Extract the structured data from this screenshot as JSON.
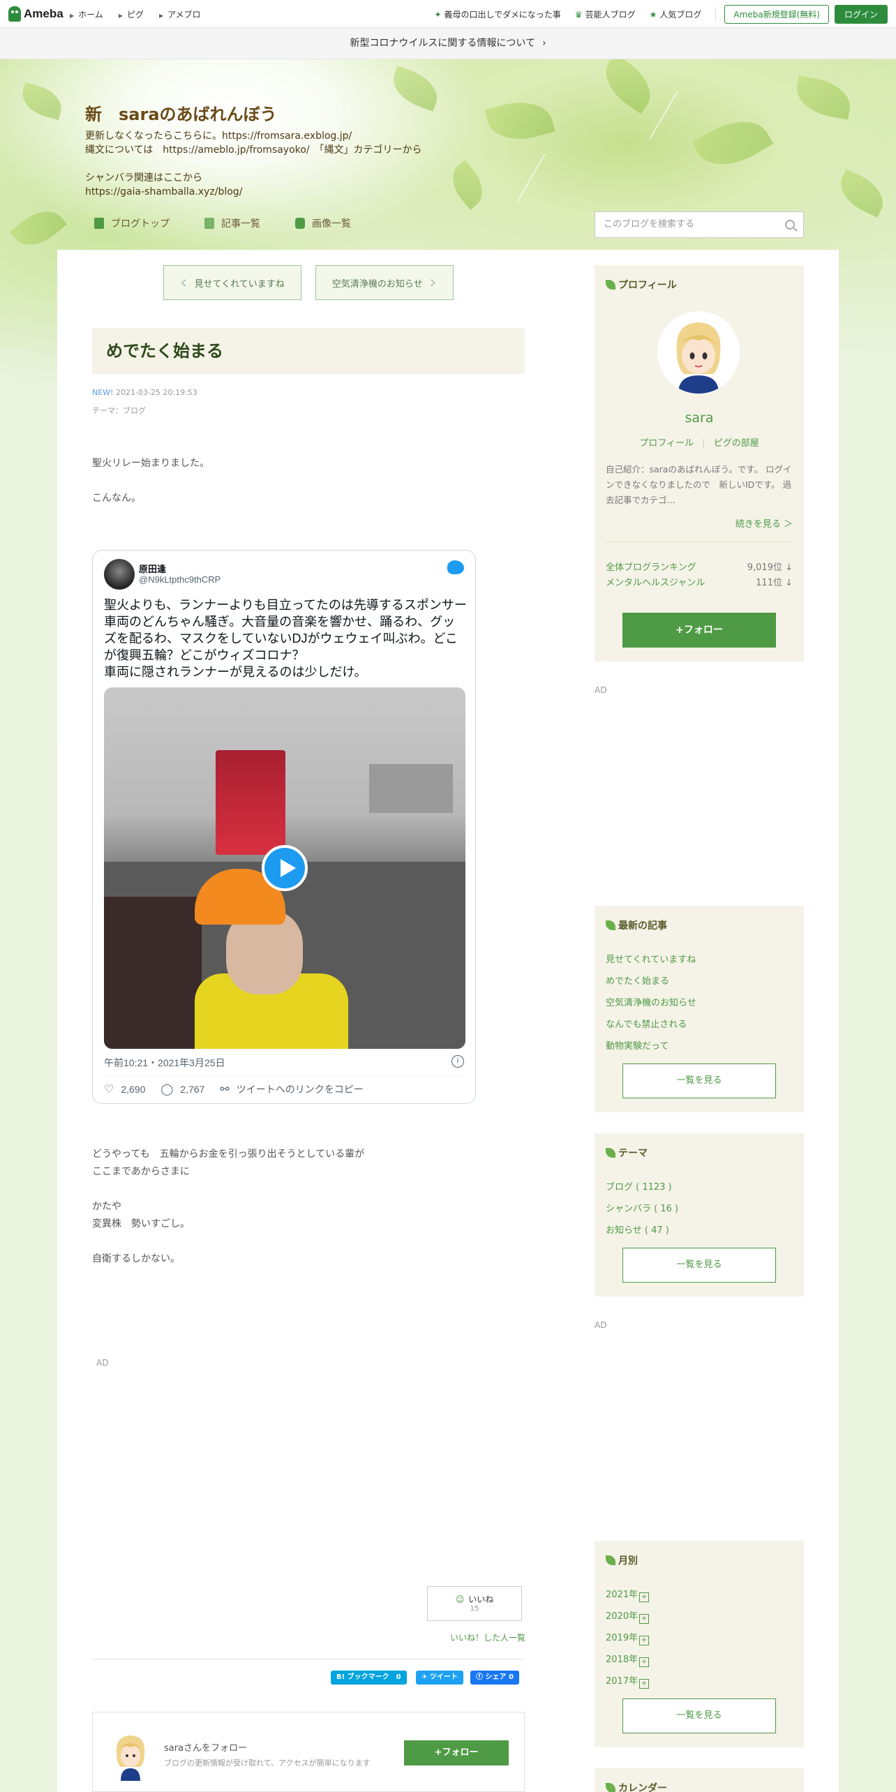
{
  "global_header": {
    "logo": "Ameba",
    "nav": [
      "ホーム",
      "ピグ",
      "アメブロ"
    ],
    "right_links": [
      "義母の口出しでダメになった事",
      "芸能人ブログ",
      "人気ブログ"
    ],
    "register": "Ameba新規登録(無料)",
    "login": "ログイン"
  },
  "notice": "新型コロナウイルスに関する情報について",
  "blog": {
    "title": "新　saraのあばれんぼう",
    "description": "更新しなくなったらこちらに。https://fromsara.exblog.jp/\n縄文については　https://ameblo.jp/fromsayoko/　「縄文」カテゴリーから\n\nシャンバラ関連はここから\nhttps://gaia-shamballa.xyz/blog/",
    "nav": [
      "ブログトップ",
      "記事一覧",
      "画像一覧"
    ],
    "search_placeholder": "このブログを検索する"
  },
  "pager": {
    "prev": "見せてくれていますね",
    "next": "空気清浄機のお知らせ"
  },
  "entry": {
    "title": "めでたく始まる",
    "new_label": "NEW!",
    "datetime": "2021-03-25 20:19:53",
    "theme_label": "テーマ：",
    "theme": "ブログ",
    "body1": "聖火リレー始まりました。\n\nこんなん。",
    "body2": "どうやっても　五輪からお金を引っ張り出そうとしている輩が\nここまであからさまに\n\nかたや\n変異株　勢いすごし。\n\n自衛するしかない。"
  },
  "tweet": {
    "name": "原田逢",
    "handle": "@N9kLtpthc9thCRP",
    "text": "聖火よりも、ランナーよりも目立ってたのは先導するスポンサー車両のどんちゃん騒ぎ。大音量の音楽を響かせ、踊るわ、グッズを配るわ、マスクをしていないDJがウェウェイ叫ぶわ。どこが復興五輪？どこがウィズコロナ？\n車両に隠されランナーが見えるのは少しだけ。",
    "time": "午前10:21・2021年3月25日",
    "likes": "2,690",
    "replies": "2,767",
    "copy_link": "ツイートへのリンクをコピー",
    "info": "i"
  },
  "ads": {
    "label": "AD"
  },
  "like": {
    "label": "いいね",
    "count": "15",
    "list": "いいね！した人一覧"
  },
  "share": {
    "hatena": "B! ブックマーク",
    "hatena_count": "0",
    "twitter": "ツイート",
    "facebook": "シェア",
    "facebook_count": "0"
  },
  "follow_card": {
    "title": "saraさんをフォロー",
    "subtitle": "ブログの更新情報が受け取れて、アクセスが簡単になります",
    "button": "+フォロー"
  },
  "sidebar": {
    "profile": {
      "heading": "プロフィール",
      "name": "sara",
      "link1": "プロフィール",
      "link2": "ピグの部屋",
      "intro": "自己紹介：saraのあばれんぼう。です。 ログインできなくなりましたので　新しいIDです。 過去記事でカテゴ...",
      "more": "続きを見る ＞",
      "rank1_label": "全体ブログランキング",
      "rank1_value": "9,019位 ↓",
      "rank2_label": "メンタルヘルスジャンル",
      "rank2_value": "111位 ↓",
      "follow": "+フォロー"
    },
    "recent": {
      "heading": "最新の記事",
      "items": [
        "見せてくれていますね",
        "めでたく始まる",
        "空気清浄機のお知らせ",
        "なんでも禁止される",
        "動物実験だって"
      ],
      "button": "一覧を見る"
    },
    "themes": {
      "heading": "テーマ",
      "items": [
        "ブログ ( 1123 )",
        "シャンバラ ( 16 )",
        "お知らせ ( 47 )"
      ],
      "button": "一覧を見る"
    },
    "monthly": {
      "heading": "月別",
      "items": [
        "2021年",
        "2020年",
        "2019年",
        "2018年",
        "2017年"
      ],
      "button": "一覧を見る"
    },
    "calendar": {
      "heading": "カレンダー"
    }
  }
}
